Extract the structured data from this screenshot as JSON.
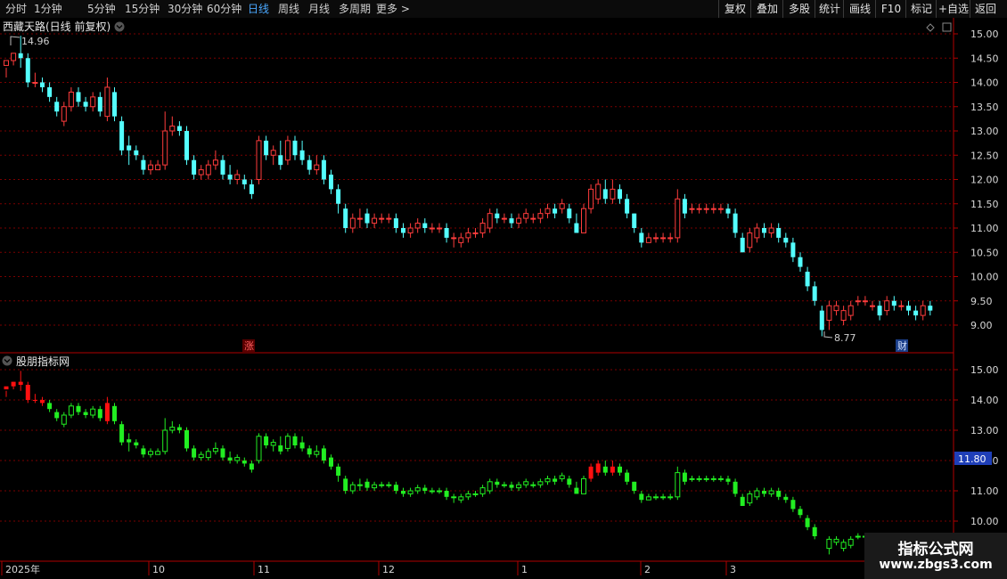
{
  "toolbar": {
    "periods": [
      "分时",
      "1分钟",
      "5分钟",
      "15分钟",
      "30分钟",
      "60分钟",
      "日线",
      "周线",
      "月线",
      "多周期",
      "更多 >"
    ],
    "active_period": "日线",
    "buttons": [
      "复权",
      "叠加",
      "多股",
      "统计",
      "画线",
      "F10",
      "标记",
      "+自选",
      "返回"
    ]
  },
  "main_panel": {
    "title": "西藏天路(日线 前复权)",
    "high_label": "14.96",
    "low_label": "8.77",
    "axis_ticks": [
      "15.00",
      "14.50",
      "14.00",
      "13.50",
      "13.00",
      "12.50",
      "12.00",
      "11.50",
      "11.00",
      "10.50",
      "10.00",
      "9.50",
      "9.00"
    ],
    "markers": [
      "涨",
      "财"
    ]
  },
  "sub_panel": {
    "title": "股朋指标网",
    "axis_ticks": [
      "15.00",
      "14.00",
      "13.00",
      "12.00",
      "11.00",
      "10.00"
    ],
    "price_tag": "11.80"
  },
  "time_axis": [
    "2025年",
    "10",
    "11",
    "12",
    "1",
    "2",
    "3"
  ],
  "colors": {
    "up": "#ff3c3c",
    "down": "#54ffff",
    "sub_up": "#ff1010",
    "sub_down": "#22ee22",
    "grid": "#7a0000",
    "tag_bg": "#1f3fb8"
  },
  "watermark": {
    "line1": "指标公式网",
    "line2": "www.zbgs3.com"
  },
  "candles": [
    [
      14.35,
      14.45,
      14.3,
      14.1
    ],
    [
      14.45,
      14.6,
      14.6,
      14.35
    ],
    [
      14.6,
      14.5,
      14.96,
      14.3
    ],
    [
      14.5,
      14.0,
      14.6,
      13.9
    ],
    [
      14.0,
      14.0,
      14.2,
      13.9
    ],
    [
      14.0,
      13.9,
      14.1,
      13.8
    ],
    [
      13.9,
      13.7,
      14.0,
      13.6
    ],
    [
      13.6,
      13.4,
      13.7,
      13.3
    ],
    [
      13.2,
      13.5,
      13.6,
      13.1
    ],
    [
      13.5,
      13.8,
      13.9,
      13.4
    ],
    [
      13.8,
      13.6,
      13.9,
      13.5
    ],
    [
      13.6,
      13.5,
      13.7,
      13.4
    ],
    [
      13.5,
      13.7,
      13.8,
      13.4
    ],
    [
      13.7,
      13.4,
      13.8,
      13.3
    ],
    [
      13.3,
      13.9,
      14.1,
      13.2
    ],
    [
      13.8,
      13.3,
      13.9,
      13.2
    ],
    [
      13.2,
      12.6,
      13.3,
      12.5
    ],
    [
      12.7,
      12.6,
      12.9,
      12.3
    ],
    [
      12.6,
      12.5,
      12.7,
      12.4
    ],
    [
      12.4,
      12.2,
      12.5,
      12.1
    ],
    [
      12.2,
      12.3,
      12.4,
      12.1
    ],
    [
      12.2,
      12.3,
      12.4,
      12.2
    ],
    [
      12.3,
      13.0,
      13.4,
      12.2
    ],
    [
      13.0,
      13.1,
      13.3,
      12.9
    ],
    [
      13.1,
      13.0,
      13.2,
      12.9
    ],
    [
      13.0,
      12.4,
      13.1,
      12.3
    ],
    [
      12.4,
      12.1,
      12.5,
      12.0
    ],
    [
      12.1,
      12.2,
      12.3,
      12.0
    ],
    [
      12.1,
      12.3,
      12.4,
      12.0
    ],
    [
      12.3,
      12.4,
      12.6,
      12.2
    ],
    [
      12.4,
      12.1,
      12.5,
      12.0
    ],
    [
      12.1,
      12.0,
      12.3,
      11.9
    ],
    [
      12.0,
      12.1,
      12.2,
      11.9
    ],
    [
      12.0,
      11.9,
      12.1,
      11.8
    ],
    [
      11.9,
      11.7,
      12.0,
      11.6
    ],
    [
      12.0,
      12.8,
      12.9,
      11.9
    ],
    [
      12.8,
      12.5,
      12.9,
      12.4
    ],
    [
      12.5,
      12.6,
      12.7,
      12.3
    ],
    [
      12.5,
      12.3,
      12.8,
      12.2
    ],
    [
      12.4,
      12.8,
      12.9,
      12.3
    ],
    [
      12.8,
      12.5,
      12.9,
      12.4
    ],
    [
      12.6,
      12.4,
      12.8,
      12.3
    ],
    [
      12.4,
      12.2,
      12.5,
      12.1
    ],
    [
      12.2,
      12.3,
      12.5,
      12.1
    ],
    [
      12.4,
      12.0,
      12.5,
      11.9
    ],
    [
      12.1,
      11.8,
      12.2,
      11.7
    ],
    [
      11.8,
      11.5,
      11.9,
      11.3
    ],
    [
      11.4,
      11.0,
      11.5,
      10.9
    ],
    [
      11.0,
      11.2,
      11.3,
      10.9
    ],
    [
      11.2,
      11.2,
      11.4,
      11.0
    ],
    [
      11.3,
      11.1,
      11.4,
      11.0
    ],
    [
      11.1,
      11.2,
      11.3,
      11.0
    ],
    [
      11.2,
      11.2,
      11.3,
      11.1
    ],
    [
      11.2,
      11.2,
      11.3,
      11.1
    ],
    [
      11.2,
      11.0,
      11.3,
      10.9
    ],
    [
      11.0,
      10.9,
      11.1,
      10.8
    ],
    [
      10.9,
      11.0,
      11.1,
      10.8
    ],
    [
      11.0,
      11.1,
      11.2,
      10.9
    ],
    [
      11.1,
      11.0,
      11.2,
      10.9
    ],
    [
      11.0,
      11.0,
      11.1,
      10.9
    ],
    [
      11.0,
      11.0,
      11.1,
      10.9
    ],
    [
      11.0,
      10.8,
      11.1,
      10.7
    ],
    [
      10.8,
      10.8,
      10.9,
      10.6
    ],
    [
      10.7,
      10.8,
      10.9,
      10.6
    ],
    [
      10.8,
      10.9,
      11.0,
      10.7
    ],
    [
      10.9,
      10.9,
      11.0,
      10.8
    ],
    [
      10.9,
      11.1,
      11.2,
      10.8
    ],
    [
      11.0,
      11.3,
      11.4,
      10.9
    ],
    [
      11.3,
      11.2,
      11.4,
      11.1
    ],
    [
      11.2,
      11.2,
      11.3,
      11.1
    ],
    [
      11.2,
      11.1,
      11.3,
      11.0
    ],
    [
      11.1,
      11.2,
      11.3,
      11.0
    ],
    [
      11.2,
      11.3,
      11.4,
      11.1
    ],
    [
      11.2,
      11.2,
      11.3,
      11.1
    ],
    [
      11.2,
      11.3,
      11.4,
      11.1
    ],
    [
      11.3,
      11.4,
      11.5,
      11.2
    ],
    [
      11.4,
      11.3,
      11.5,
      11.2
    ],
    [
      11.4,
      11.5,
      11.6,
      11.3
    ],
    [
      11.4,
      11.2,
      11.5,
      11.1
    ],
    [
      11.1,
      10.9,
      11.3,
      10.9
    ],
    [
      10.9,
      11.4,
      11.5,
      10.9
    ],
    [
      11.4,
      11.8,
      11.9,
      11.3
    ],
    [
      11.6,
      11.9,
      12.0,
      11.5
    ],
    [
      11.8,
      11.6,
      12.0,
      11.5
    ],
    [
      11.6,
      11.8,
      12.0,
      11.5
    ],
    [
      11.8,
      11.6,
      11.9,
      11.5
    ],
    [
      11.6,
      11.3,
      11.7,
      11.2
    ],
    [
      11.3,
      11.0,
      11.3,
      10.9
    ],
    [
      10.9,
      10.7,
      11.0,
      10.6
    ],
    [
      10.7,
      10.8,
      10.9,
      10.7
    ],
    [
      10.8,
      10.8,
      10.9,
      10.7
    ],
    [
      10.8,
      10.8,
      10.9,
      10.7
    ],
    [
      10.8,
      10.8,
      10.9,
      10.7
    ],
    [
      10.8,
      11.6,
      11.8,
      10.7
    ],
    [
      11.6,
      11.3,
      11.7,
      11.2
    ],
    [
      11.4,
      11.4,
      11.5,
      11.3
    ],
    [
      11.4,
      11.4,
      11.5,
      11.3
    ],
    [
      11.4,
      11.4,
      11.5,
      11.3
    ],
    [
      11.4,
      11.4,
      11.5,
      11.3
    ],
    [
      11.4,
      11.4,
      11.5,
      11.3
    ],
    [
      11.4,
      11.3,
      11.5,
      11.2
    ],
    [
      11.3,
      10.9,
      11.4,
      10.8
    ],
    [
      10.8,
      10.5,
      10.9,
      10.5
    ],
    [
      10.6,
      10.9,
      11.0,
      10.5
    ],
    [
      10.8,
      11.0,
      11.1,
      10.7
    ],
    [
      11.0,
      10.9,
      11.1,
      10.8
    ],
    [
      10.9,
      11.0,
      11.1,
      10.8
    ],
    [
      11.0,
      10.8,
      11.1,
      10.7
    ],
    [
      10.8,
      10.7,
      10.9,
      10.6
    ],
    [
      10.7,
      10.4,
      10.8,
      10.3
    ],
    [
      10.4,
      10.2,
      10.5,
      10.1
    ],
    [
      10.1,
      9.8,
      10.2,
      9.7
    ],
    [
      9.8,
      9.5,
      9.9,
      9.4
    ],
    [
      9.3,
      8.9,
      9.4,
      8.77
    ],
    [
      9.1,
      9.4,
      9.5,
      8.9
    ],
    [
      9.3,
      9.4,
      9.5,
      9.2
    ],
    [
      9.1,
      9.3,
      9.4,
      9.0
    ],
    [
      9.2,
      9.4,
      9.5,
      9.1
    ],
    [
      9.5,
      9.5,
      9.6,
      9.4
    ],
    [
      9.5,
      9.5,
      9.6,
      9.4
    ],
    [
      9.4,
      9.4,
      9.5,
      9.3
    ],
    [
      9.4,
      9.2,
      9.5,
      9.1
    ],
    [
      9.3,
      9.5,
      9.6,
      9.2
    ],
    [
      9.5,
      9.4,
      9.6,
      9.3
    ],
    [
      9.4,
      9.4,
      9.5,
      9.3
    ],
    [
      9.4,
      9.3,
      9.5,
      9.2
    ],
    [
      9.3,
      9.2,
      9.4,
      9.1
    ],
    [
      9.2,
      9.4,
      9.5,
      9.1
    ],
    [
      9.4,
      9.3,
      9.5,
      9.2
    ]
  ]
}
